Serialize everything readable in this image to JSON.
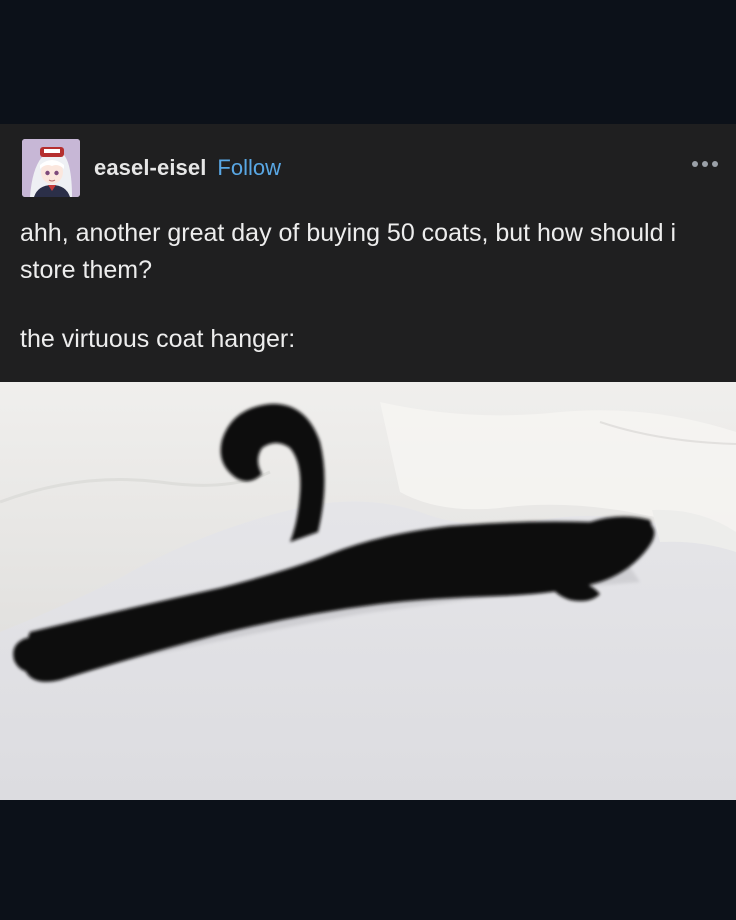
{
  "post": {
    "author": {
      "username": "easel-eisel",
      "follow_label": "Follow",
      "avatar_icon": "anime-avatar"
    },
    "menu_icon": "more-options-icon",
    "body": {
      "line1": "ahh, another great day of buying 50 coats, but how should i store them?",
      "line2": "the virtuous coat hanger:"
    },
    "image": {
      "subject": "black-cat-stretched-on-white-bedsheet"
    }
  },
  "colors": {
    "background": "#0c1119",
    "post_background": "#1f1f20",
    "text": "#ededed",
    "follow": "#59a7e4",
    "sheet": "#e4e4e6",
    "cat": "#0d0b0b"
  }
}
